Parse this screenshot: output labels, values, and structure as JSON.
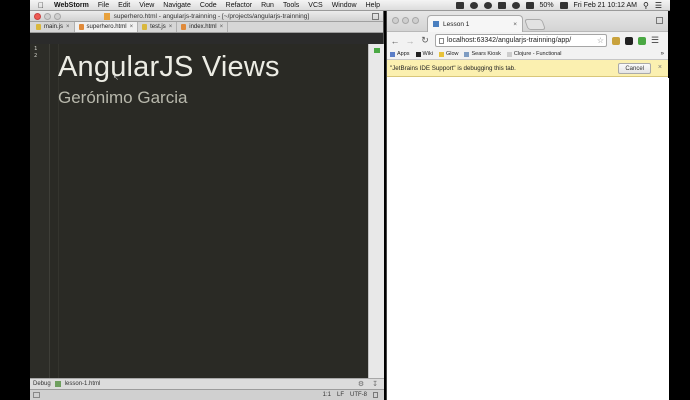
{
  "menubar": {
    "app_name": "WebStorm",
    "items": [
      "File",
      "Edit",
      "View",
      "Navigate",
      "Code",
      "Refactor",
      "Run",
      "Tools",
      "VCS",
      "Window",
      "Help"
    ],
    "battery": "50%",
    "clock": "Fri Feb 21  10:12 AM"
  },
  "ide": {
    "window_title": "superhero.html - angularjs-trainning - [~/projects/angularjs-trainning]",
    "tabs": [
      {
        "label": "main.js",
        "color": "#d9b73c",
        "active": false
      },
      {
        "label": "superhero.html",
        "color": "#e08a3a",
        "active": true
      },
      {
        "label": "test.js",
        "color": "#d9b73c",
        "active": false
      },
      {
        "label": "index.html",
        "color": "#e08a3a",
        "active": false
      }
    ],
    "line_numbers": [
      "1",
      "2"
    ],
    "heading": "AngularJS Views",
    "subheading": "Gerónimo Garcia",
    "debug_label": "Debug",
    "debug_config": "lesson-1.html",
    "status": {
      "position": "1:1",
      "line_sep": "LF",
      "encoding": "UTF-8"
    }
  },
  "chrome": {
    "tab_title": "Lesson 1",
    "url": "localhost:63342/angularjs-trainning/app/",
    "bookmarks": [
      {
        "label": "Apps",
        "color": "#5a7dc7"
      },
      {
        "label": "Wiki",
        "color": "#222222"
      },
      {
        "label": "Glow",
        "color": "#e8c23a"
      },
      {
        "label": "Sears Kiosk",
        "color": "#7e9cc2"
      },
      {
        "label": "Clojure - Functional",
        "color": "#cccccc"
      }
    ],
    "bookmarks_more": "»",
    "infobar_message": "\"JetBrains IDE Support\" is debugging this tab.",
    "infobar_cancel": "Cancel"
  }
}
